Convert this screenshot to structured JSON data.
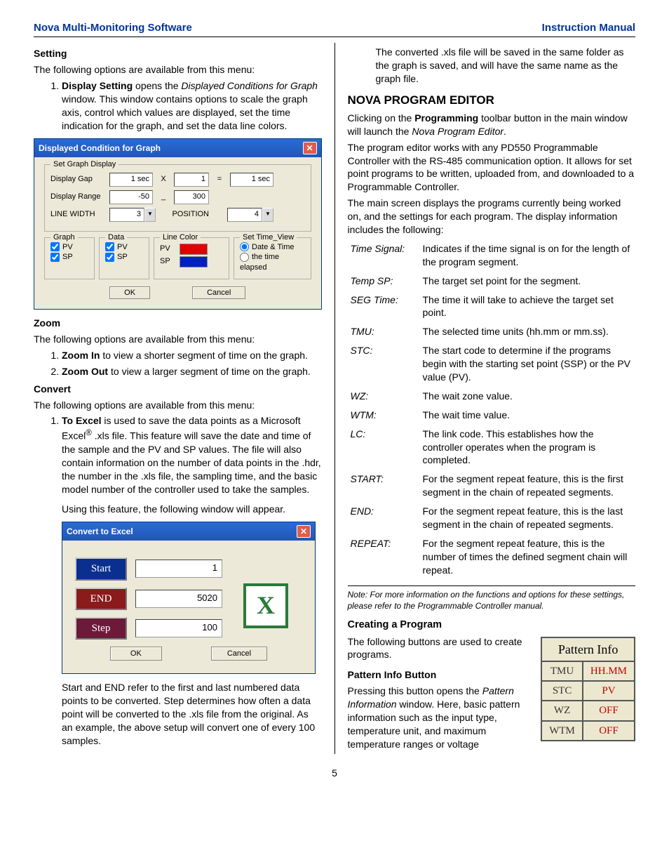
{
  "header": {
    "left": "Nova Multi-Monitoring Software",
    "right": "Instruction Manual"
  },
  "page_number": "5",
  "left": {
    "setting": {
      "heading": "Setting",
      "intro": "The following options are available from this menu:",
      "item1_lead": "Display Setting",
      "item1_rest": " opens the ",
      "item1_ital": "Displayed Conditions for Graph",
      "item1_tail": " window. This window contains options to scale the graph axis, control which values are displayed, set the time indication for the graph, and set the data line colors."
    },
    "zoom": {
      "heading": "Zoom",
      "intro": "The following options are available from this menu:",
      "item1_lead": "Zoom In",
      "item1_tail": " to view a shorter segment of time on the graph.",
      "item2_lead": "Zoom Out",
      "item2_tail": " to view a larger segment of time on the graph."
    },
    "convert": {
      "heading": "Convert",
      "intro": "The following options are available from this menu:",
      "item1_lead": "To Excel",
      "item1_rest": " is used to save the data points as a Microsoft Excel",
      "item1_sup": "®",
      "item1_tail": " .xls file. This feature will save the date and time of the sample and the PV and SP values. The file will also contain information on the number of data points in the .hdr, the number in the .xls file, the sampling time, and the basic model number of the controller used to take the samples.",
      "item1_follow": "Using this feature, the following window will appear.",
      "tail_para": "Start and END refer to the first and last numbered data points to be converted. Step determines how often a data point will be converted to the .xls file from the original.  As an example, the above setup will convert one of every 100 samples."
    },
    "dlg1": {
      "title": "Displayed Condition for Graph",
      "legend_main": "Set Graph Display",
      "row1": {
        "label": "Display Gap",
        "v1": "1 sec",
        "op1": "X",
        "v2": "1",
        "op2": "=",
        "v3": "1 sec"
      },
      "row2": {
        "label": "Display Range",
        "v1": "-50",
        "op1": "_",
        "v2": "300"
      },
      "row3": {
        "label": "LINE WIDTH",
        "v1": "3",
        "label2": "POSITION",
        "v2": "4"
      },
      "legend_graph": "Graph",
      "legend_data": "Data",
      "legend_linecolor": "Line Color",
      "legend_settime": "Set Time_View",
      "pv": "PV",
      "sp": "SP",
      "opt_datetime": "Date & Time",
      "opt_elapsed": "the time elapsed",
      "ok": "OK",
      "cancel": "Cancel"
    },
    "dlg2": {
      "title": "Convert to Excel",
      "start": "Start",
      "end": "END",
      "step": "Step",
      "v_start": "1",
      "v_end": "5020",
      "v_step": "100",
      "ok": "OK",
      "cancel": "Cancel"
    }
  },
  "right": {
    "para_top": "The converted .xls file will be saved in the same folder as the graph is saved, and will have the same name as the graph file.",
    "editor": {
      "heading": "NOVA PROGRAM EDITOR",
      "p1_a": "Clicking on the ",
      "p1_b": "Programming",
      "p1_c": " toolbar button in the main window will launch the ",
      "p1_d": "Nova Program Editor",
      "p1_e": ".",
      "p2": "The program editor works with any PD550 Programmable Controller with the RS-485 communication option. It allows for set point programs to be written, uploaded from, and downloaded to a Programmable Controller.",
      "p3": "The main screen displays the programs currently being worked on, and the settings for each program. The display information includes the following:"
    },
    "defs": [
      {
        "k": "Time Signal:",
        "v": "Indicates if the time signal is on for the length of the program segment."
      },
      {
        "k": "Temp SP:",
        "v": "The target set point for the segment."
      },
      {
        "k": "SEG Time:",
        "v": "The time it will take to achieve the target set point."
      },
      {
        "k": "TMU:",
        "v": "The selected time units (hh.mm or mm.ss)."
      },
      {
        "k": "STC:",
        "v": "The start code to determine if the programs begin with the starting set point (SSP) or the PV value (PV)."
      },
      {
        "k": "WZ:",
        "v": "The wait zone value."
      },
      {
        "k": "WTM:",
        "v": "The wait time value."
      },
      {
        "k": "LC:",
        "v": "The link code. This establishes how the controller operates when the program is completed."
      },
      {
        "k": "START:",
        "v": "For the segment repeat feature, this is the first segment in the chain of repeated segments."
      },
      {
        "k": "END:",
        "v": "For the segment repeat feature, this is the last segment in the chain of repeated segments."
      },
      {
        "k": "REPEAT:",
        "v": "For the segment repeat feature, this is the number of times the defined segment chain will repeat."
      }
    ],
    "note": "Note: For more information on the functions and options for these settings, please refer to the Programmable Controller manual.",
    "creating": {
      "heading": "Creating a Program",
      "p1": "The following buttons are used to create programs.",
      "sub": "Pattern Info Button",
      "p2_a": "Pressing this button opens the ",
      "p2_b": "Pattern Information",
      "p2_c": " window. Here, basic pattern information such as the input type, temperature unit, and maximum temperature ranges or voltage"
    },
    "pattern": {
      "title": "Pattern Info",
      "rows": [
        {
          "k": "TMU",
          "v": "HH.MM"
        },
        {
          "k": "STC",
          "v": "PV"
        },
        {
          "k": "WZ",
          "v": "OFF"
        },
        {
          "k": "WTM",
          "v": "OFF"
        }
      ]
    }
  }
}
